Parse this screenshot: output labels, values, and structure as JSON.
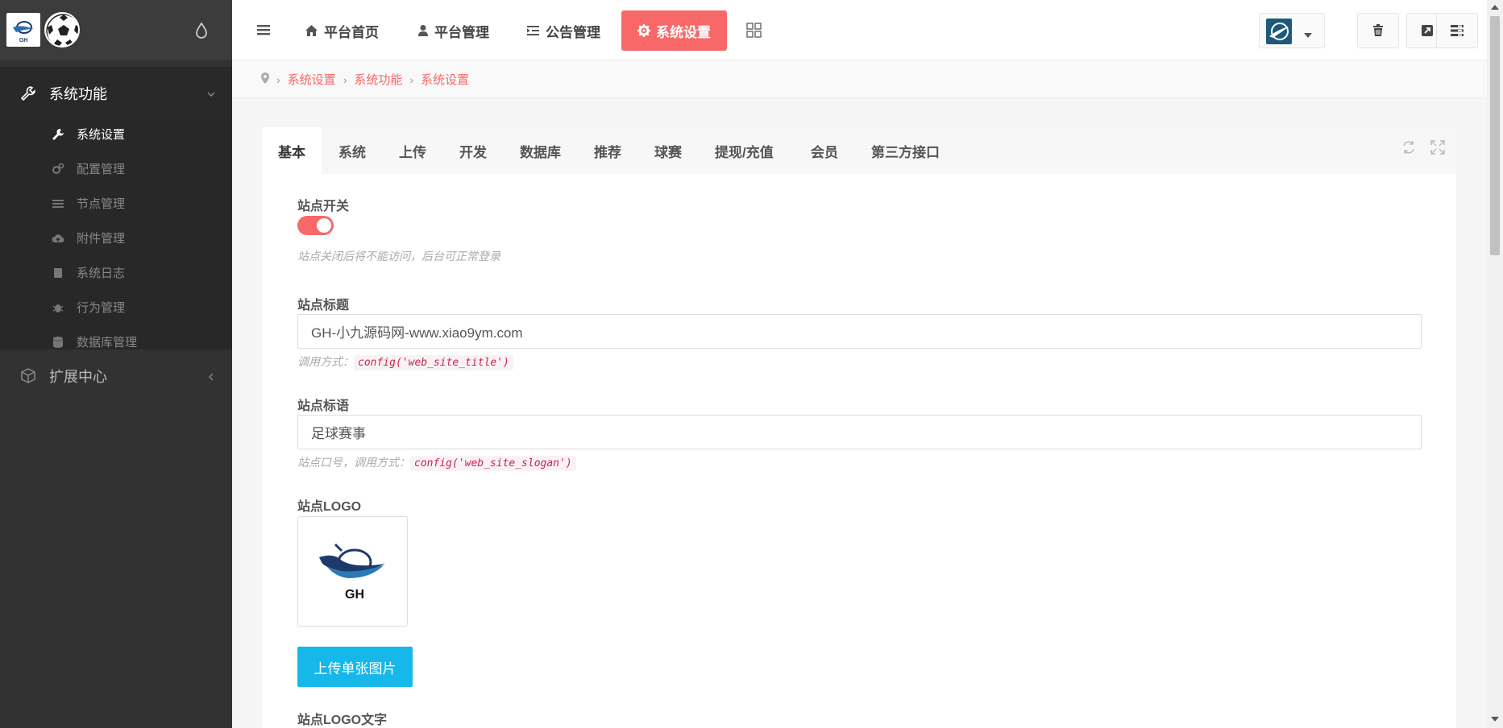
{
  "sidebar": {
    "groups": [
      {
        "label": "系统功能",
        "icon": "wrench-icon"
      },
      {
        "label": "扩展中心",
        "icon": "cubes-icon"
      }
    ],
    "items": [
      {
        "label": "系统设置",
        "icon": "wrench-icon"
      },
      {
        "label": "配置管理",
        "icon": "gears-icon"
      },
      {
        "label": "节点管理",
        "icon": "list-icon"
      },
      {
        "label": "附件管理",
        "icon": "cloud-upload-icon"
      },
      {
        "label": "系统日志",
        "icon": "book-icon"
      },
      {
        "label": "行为管理",
        "icon": "bug-icon"
      },
      {
        "label": "数据库管理",
        "icon": "database-icon"
      }
    ]
  },
  "topnav": {
    "items": [
      {
        "label": "平台首页",
        "icon": "home-icon"
      },
      {
        "label": "平台管理",
        "icon": "user-icon"
      },
      {
        "label": "公告管理",
        "icon": "indent-icon"
      },
      {
        "label": "系统设置",
        "icon": "gear-icon"
      }
    ]
  },
  "breadcrumb": [
    "系统设置",
    "系统功能",
    "系统设置"
  ],
  "tabs": [
    "基本",
    "系统",
    "上传",
    "开发",
    "数据库",
    "推荐",
    "球赛",
    "提现/充值",
    "会员",
    "第三方接口"
  ],
  "form": {
    "site_switch": {
      "label": "站点开关",
      "help": "站点关闭后将不能访问，后台可正常登录",
      "value": true
    },
    "site_title": {
      "label": "站点标题",
      "value": "GH-小九源码网-www.xiao9ym.com",
      "help_prefix": "调用方式：",
      "help_code": "config('web_site_title')"
    },
    "site_slogan": {
      "label": "站点标语",
      "value": "足球赛事",
      "help_prefix": "站点口号，调用方式：",
      "help_code": "config('web_site_slogan')"
    },
    "site_logo": {
      "label": "站点LOGO",
      "logo_text": "GH",
      "upload_label": "上传单张图片"
    },
    "site_logo_text": {
      "label": "站点LOGO文字"
    }
  },
  "colors": {
    "accent": "#f96868",
    "upload": "#15b8e8",
    "sidebar": "#323232"
  }
}
